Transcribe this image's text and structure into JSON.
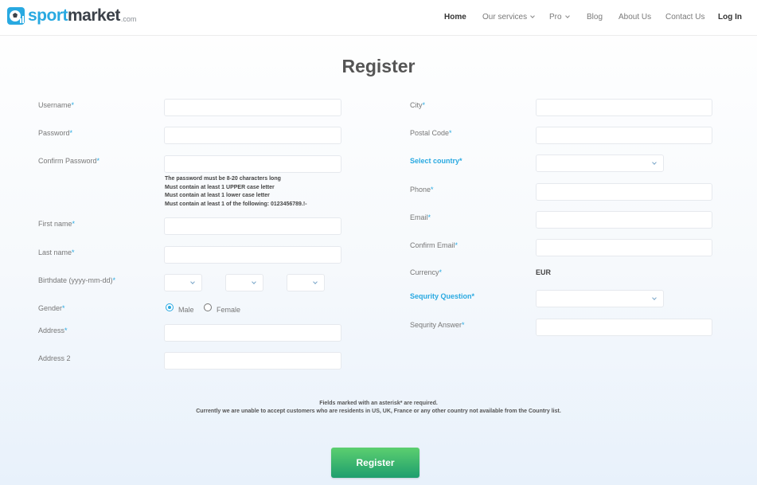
{
  "header": {
    "logo": {
      "part1": "sport",
      "part2": "market",
      "suffix": ".com",
      "icon": "soccer-ball-icon"
    },
    "nav": [
      "Home",
      "Our services",
      "Pro",
      "Blog",
      "About Us",
      "Contact Us",
      "Log In"
    ]
  },
  "title": "Register",
  "left": {
    "username": "Username",
    "password": "Password",
    "confirm_password": "Confirm Password",
    "password_rules": [
      "The password must be 8-20 characters long",
      "Must contain at least 1 UPPER case letter",
      "Must contain at least 1 lower case letter",
      "Must contain at least 1 of the following: 0123456789.!-"
    ],
    "first_name": "First name",
    "last_name": "Last name",
    "birthdate": "Birthdate (yyyy-mm-dd)",
    "gender": "Gender",
    "gender_options": [
      "Male",
      "Female"
    ],
    "gender_selected": "Male",
    "address": "Address",
    "address2": "Address 2"
  },
  "right": {
    "city": "City",
    "postal_code": "Postal Code",
    "select_country": "Select country",
    "phone": "Phone",
    "email": "Email",
    "confirm_email": "Confirm Email",
    "currency": "Currency",
    "currency_value": "EUR",
    "security_question": "Sequrity Question",
    "security_answer": "Sequrity Answer"
  },
  "asterisk": "*",
  "notes": {
    "required": "Fields marked with an asterisk* are required.",
    "restriction": "Currently we are unable to accept customers who are residents in US, UK, France or any other country not available from the Country list."
  },
  "submit_label": "Register",
  "colors": {
    "accent": "#29a9e1",
    "button_top": "#5ccf6f",
    "button_bottom": "#1e9e6e"
  }
}
